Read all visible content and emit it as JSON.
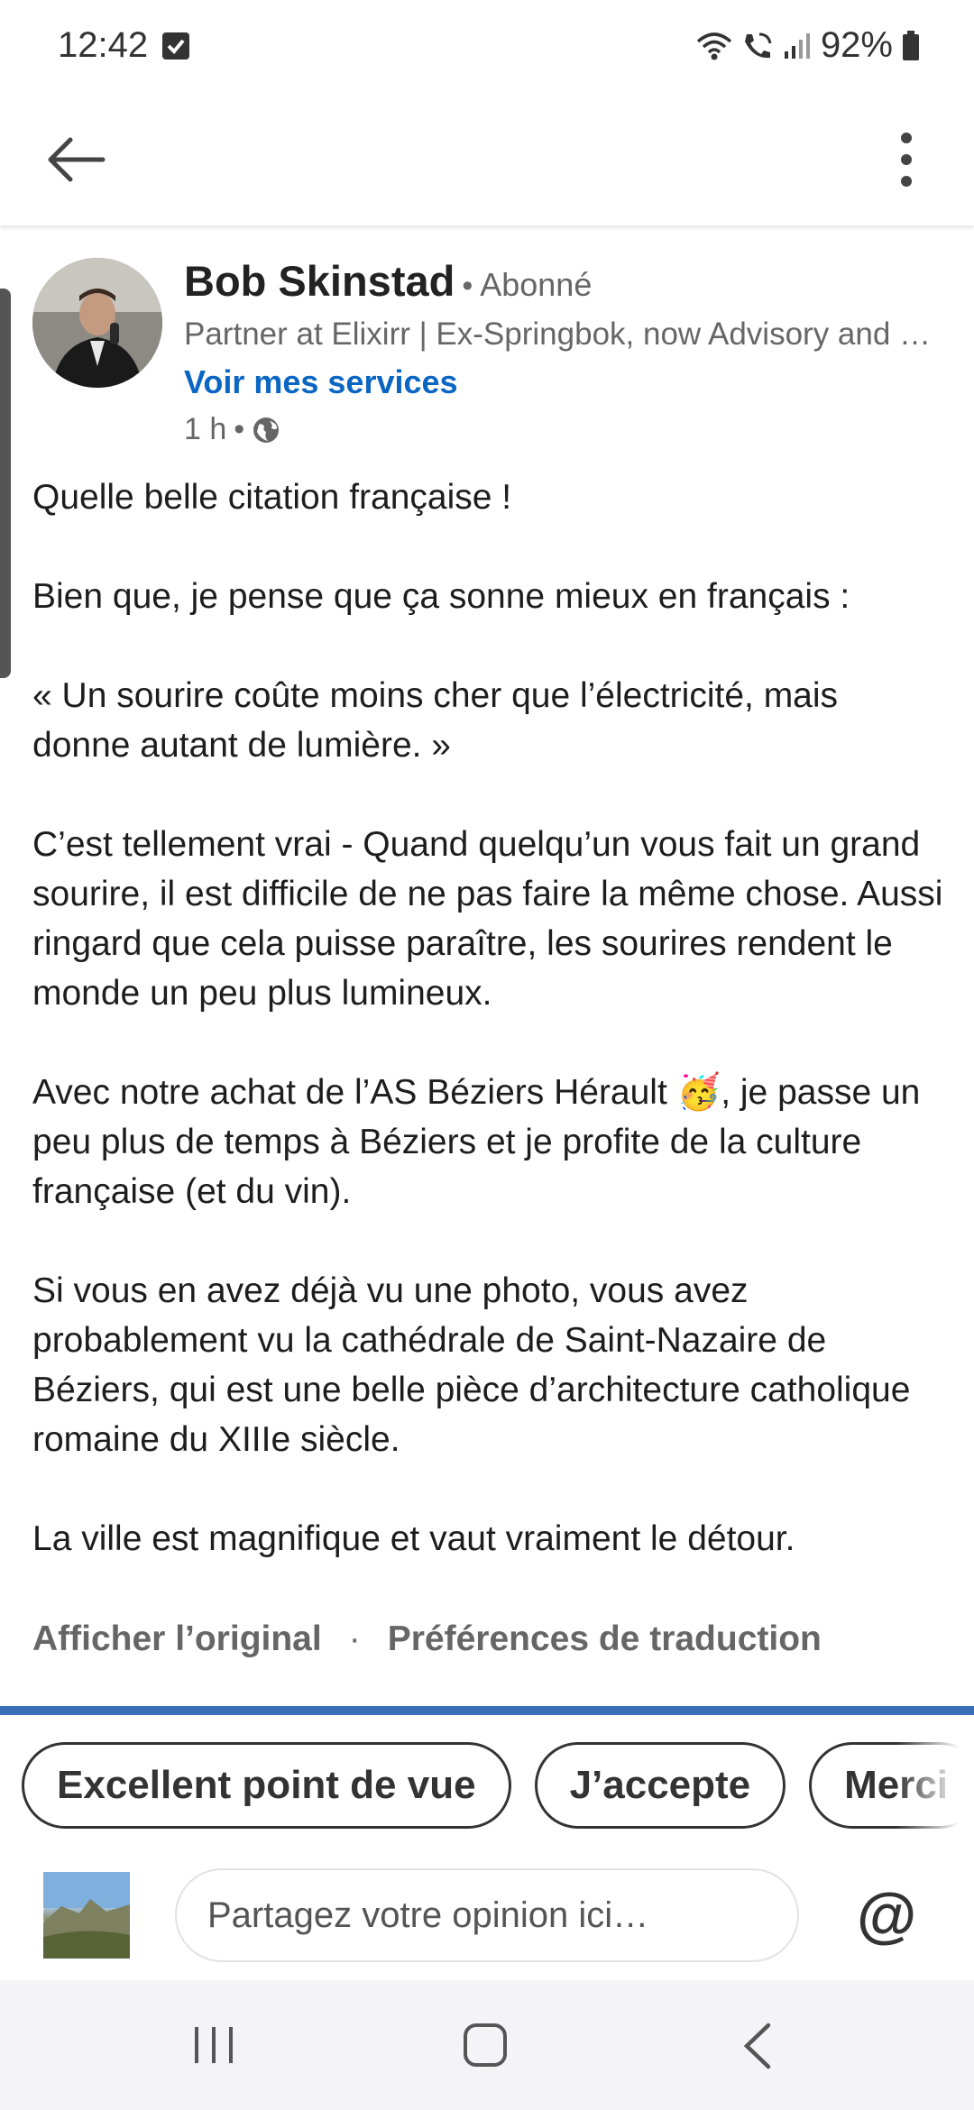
{
  "status_bar": {
    "time": "12:42",
    "battery": "92%",
    "icons": [
      "checkbox-notification-icon",
      "wifi-icon",
      "wifi-calling-icon",
      "signal-icon",
      "battery-icon"
    ]
  },
  "app_bar": {
    "back_icon": "arrow-left-icon",
    "more_icon": "more-vertical-icon"
  },
  "post": {
    "author_name": "Bob Skinstad",
    "separator": "•",
    "follow_status": "Abonné",
    "headline": "Partner at Elixirr | Ex-Springbok, now Advisory and …",
    "services_link": "Voir mes services",
    "time": "1 h",
    "meta_separator": "•",
    "visibility_icon": "globe-icon",
    "paragraphs": [
      "Quelle belle citation française !",
      "Bien que, je pense que ça sonne mieux en français :",
      "« Un sourire coûte moins cher que l’électricité, mais donne autant de lumière. »",
      "C’est tellement vrai - Quand quelqu’un vous fait un grand sourire, il est difficile de ne pas faire la même chose. Aussi ringard que cela puisse paraître, les sourires rendent le monde un peu plus lumineux.",
      "Avec notre achat de l’AS Béziers Hérault 🥳, je passe un peu plus de temps à Béziers et je profite de la culture française (et du vin).",
      "Si vous en avez déjà vu une photo, vous avez probablement vu la cathédrale de Saint-Nazaire de Béziers, qui est une belle pièce d’architecture catholique romaine du XIIIe siècle.",
      "La ville est magnifique et vaut vraiment le détour."
    ],
    "show_original": "Afficher l’original",
    "translation_separator": "·",
    "translation_prefs": "Préférences de traduction"
  },
  "suggestions": [
    "Excellent point de vue",
    "J’accepte",
    "Merci"
  ],
  "composer": {
    "placeholder": "Partagez votre opinion ici…",
    "mention_symbol": "@"
  },
  "nav_bar": {
    "icons": [
      "recents-icon",
      "home-icon",
      "back-icon"
    ]
  },
  "colors": {
    "link_blue": "#0a66c2",
    "divider_blue": "#3b6eb8",
    "text_primary": "#191919",
    "text_secondary": "#666666"
  }
}
